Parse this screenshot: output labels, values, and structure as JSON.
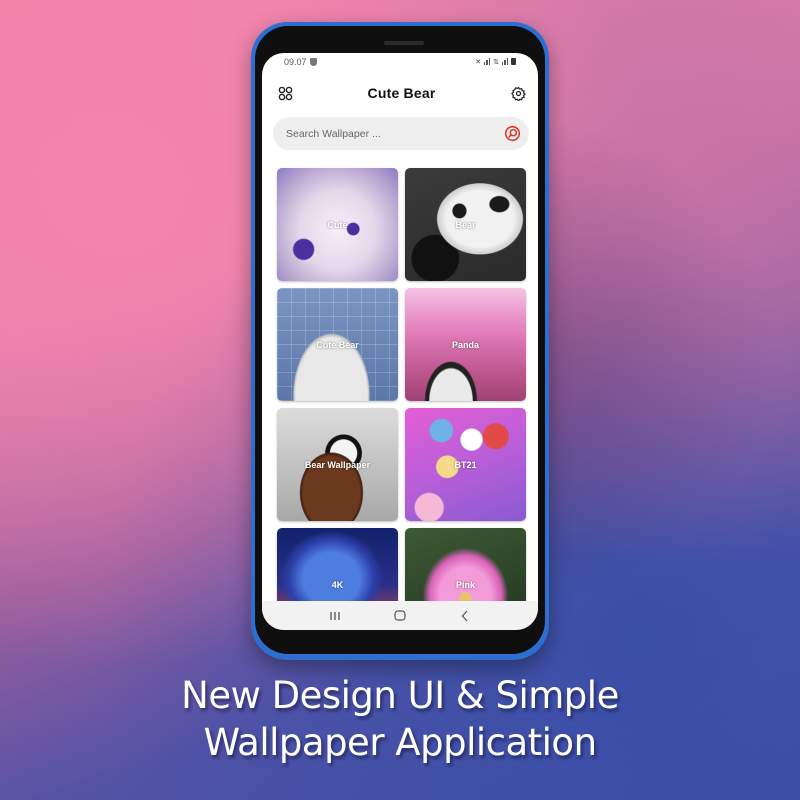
{
  "status_bar": {
    "time": "09.07",
    "right_icons": [
      "mute-icon",
      "signal-icon",
      "data-icon",
      "signal-icon",
      "battery-icon"
    ]
  },
  "app": {
    "title": "Cute Bear",
    "menu_icon": "grid-menu-icon",
    "settings_icon": "gear-icon"
  },
  "search": {
    "placeholder": "Search Wallpaper ...",
    "value": "",
    "icon": "search-icon",
    "accent_color": "#e0352b"
  },
  "categories": [
    {
      "label": "Cute"
    },
    {
      "label": "Bear"
    },
    {
      "label": "Cute Bear"
    },
    {
      "label": "Panda"
    },
    {
      "label": "Bear Wallpaper"
    },
    {
      "label": "BT21"
    },
    {
      "label": "4K"
    },
    {
      "label": "Pink"
    }
  ],
  "nav_bar": {
    "buttons": [
      "recents-icon",
      "home-icon",
      "back-icon"
    ]
  },
  "caption": {
    "line1": "New Design UI & Simple",
    "line2": "Wallpaper Application"
  },
  "colors": {
    "phone_frame": "#2d6fd0",
    "bg_top_left": "#f083a9",
    "bg_bottom_right": "#3d4ea3"
  }
}
